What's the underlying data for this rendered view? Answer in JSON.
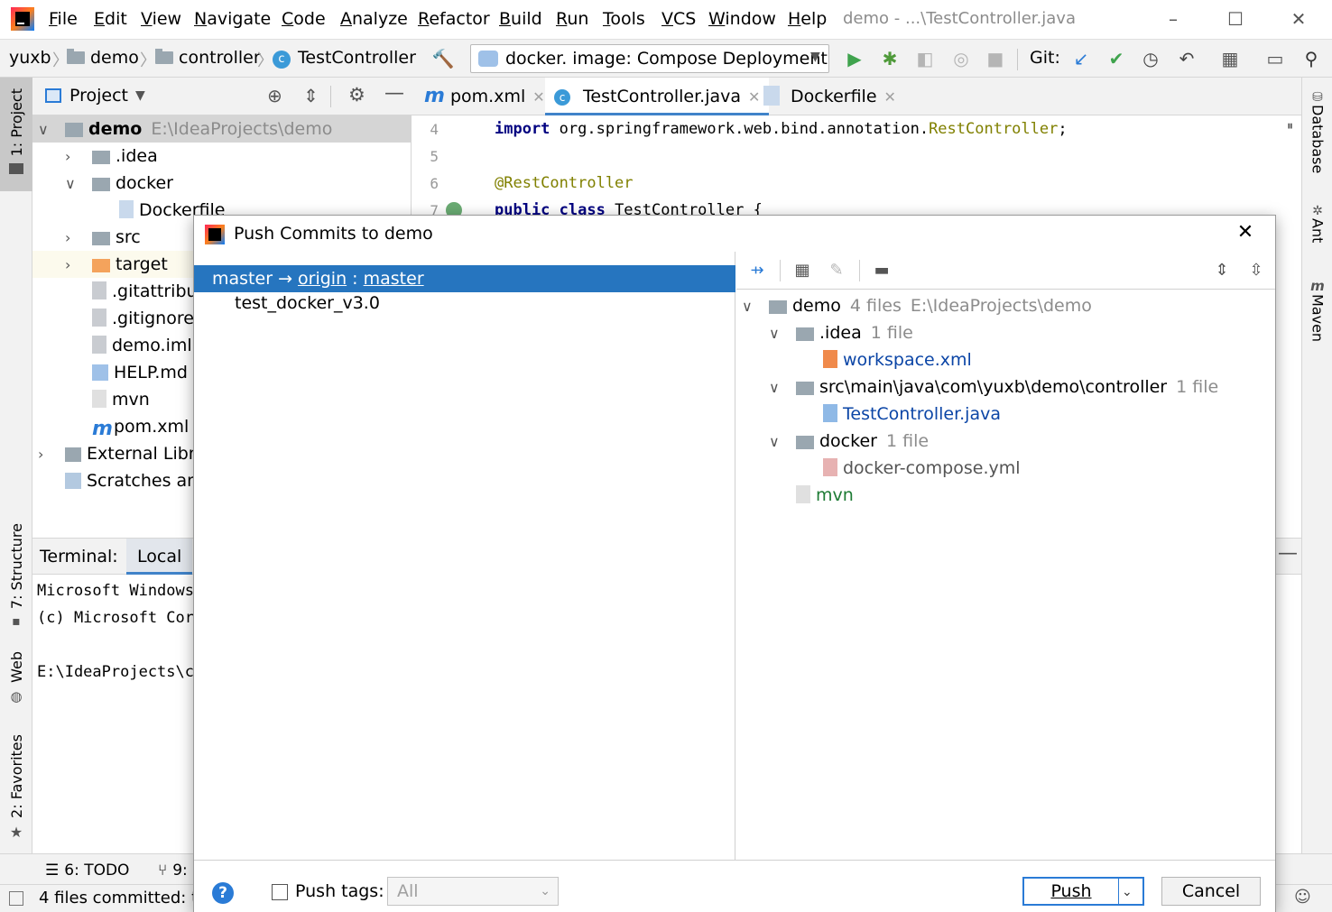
{
  "menu": [
    "File",
    "Edit",
    "View",
    "Navigate",
    "Code",
    "Analyze",
    "Refactor",
    "Build",
    "Run",
    "Tools",
    "VCS",
    "Window",
    "Help"
  ],
  "window_title": "demo - ...\\TestController.java",
  "breadcrumb": {
    "root": "yuxb",
    "project": "demo",
    "folder": "controller",
    "file": "TestController"
  },
  "run_config": "docker.  image: Compose Deployment",
  "git_label": "Git:",
  "left_tabs": {
    "project": "1: Project",
    "structure": "7: Structure",
    "web": "Web",
    "favorites": "2: Favorites"
  },
  "right_tabs": {
    "database": "Database",
    "ant": "Ant",
    "maven": "Maven"
  },
  "project_panel": {
    "title": "Project",
    "tree": [
      {
        "label": "demo",
        "extra": "E:\\IdeaProjects\\demo",
        "indent": 0,
        "arrow": "down",
        "icon": "module"
      },
      {
        "label": ".idea",
        "indent": 1,
        "arrow": "right",
        "icon": "folder"
      },
      {
        "label": "docker",
        "indent": 1,
        "arrow": "down",
        "icon": "folder"
      },
      {
        "label": "Dockerfile",
        "indent": 2,
        "arrow": "",
        "icon": "dockerfile"
      },
      {
        "label": "src",
        "indent": 1,
        "arrow": "right",
        "icon": "folder"
      },
      {
        "label": "target",
        "indent": 1,
        "arrow": "right",
        "icon": "folder-orange"
      },
      {
        "label": ".gitattribu",
        "indent": 1,
        "arrow": "",
        "icon": "file"
      },
      {
        "label": ".gitignore",
        "indent": 1,
        "arrow": "",
        "icon": "file"
      },
      {
        "label": "demo.iml",
        "indent": 1,
        "arrow": "",
        "icon": "file"
      },
      {
        "label": "HELP.md",
        "indent": 1,
        "arrow": "",
        "icon": "md"
      },
      {
        "label": "mvn",
        "indent": 1,
        "arrow": "",
        "icon": "unknown"
      },
      {
        "label": "pom.xml",
        "indent": 1,
        "arrow": "",
        "icon": "maven"
      },
      {
        "label": "External Libra",
        "indent": 0,
        "arrow": "right",
        "icon": "library"
      },
      {
        "label": "Scratches and",
        "indent": 0,
        "arrow": "",
        "icon": "scratch"
      }
    ]
  },
  "editor_tabs": [
    "pom.xml",
    "TestController.java",
    "Dockerfile"
  ],
  "editor": {
    "lines": [
      {
        "num": "4",
        "kw": "import",
        "text": " org.springframework.web.bind.annotation.",
        "ann": "RestController",
        "tail": ";"
      },
      {
        "num": "5",
        "kw": "",
        "text": "",
        "ann": "",
        "tail": ""
      },
      {
        "num": "6",
        "kw": "",
        "text": "",
        "ann": "@RestController",
        "tail": ""
      },
      {
        "num": "7",
        "kw": "public class",
        "text": " TestController {",
        "ann": "",
        "tail": ""
      }
    ]
  },
  "terminal": {
    "label": "Terminal:",
    "tab": "Local",
    "lines": [
      "Microsoft Windows",
      "(c) Microsoft Cor",
      "",
      "E:\\IdeaProjects\\c"
    ]
  },
  "bottom_tools": {
    "todo": "6: TODO",
    "vcs": "9:"
  },
  "status": "4 files committed: te",
  "dialog": {
    "title": "Push Commits to demo",
    "branch_from": "master",
    "branch_arrow": "→",
    "remote": "origin",
    "branch_sep": " : ",
    "branch_to": "master",
    "commits": [
      "test_docker_v3.0"
    ],
    "files": [
      {
        "label": "demo",
        "meta": "4 files",
        "extra": "E:\\IdeaProjects\\demo",
        "indent": 0,
        "arrow": "down",
        "color": "default"
      },
      {
        "label": ".idea",
        "meta": "1 file",
        "indent": 1,
        "arrow": "down",
        "color": "default"
      },
      {
        "label": "workspace.xml",
        "indent": 2,
        "arrow": "",
        "color": "blue"
      },
      {
        "label": "src\\main\\java\\com\\yuxb\\demo\\controller",
        "meta": "1 file",
        "indent": 1,
        "arrow": "down",
        "color": "default"
      },
      {
        "label": "TestController.java",
        "indent": 2,
        "arrow": "",
        "color": "blue"
      },
      {
        "label": "docker",
        "meta": "1 file",
        "indent": 1,
        "arrow": "down",
        "color": "default"
      },
      {
        "label": "docker-compose.yml",
        "indent": 2,
        "arrow": "",
        "color": "muted"
      },
      {
        "label": "mvn",
        "indent": 1,
        "arrow": "",
        "color": "green"
      }
    ],
    "push_tags_label": "Push tags:",
    "push_tags_value": "All",
    "push_button": "Push",
    "cancel_button": "Cancel"
  },
  "colors": {
    "selection": "#2675bf",
    "accent": "#2a7bd6",
    "run_green": "#4caf50"
  }
}
